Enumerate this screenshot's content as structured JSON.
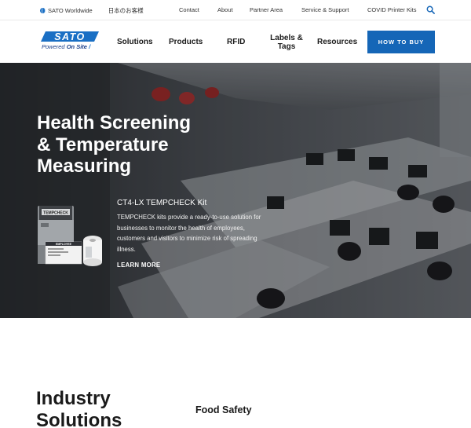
{
  "utility": {
    "worldwide": "SATO Worldwide",
    "japanese": "日本のお客様",
    "links": [
      "Contact",
      "About",
      "Partner Area",
      "Service & Support",
      "COVID Printer Kits"
    ],
    "icons": {
      "globe": "globe-icon",
      "search": "search-icon"
    }
  },
  "logo": {
    "wordmark": "SATO",
    "tagline_prefix": "Powered",
    "tagline_strong": "On Site",
    "tagline_suffix": "/"
  },
  "nav": {
    "solutions": "Solutions",
    "products": "Products",
    "rfid": "RFID",
    "labels_line1": "Labels &",
    "labels_line2": "Tags",
    "resources": "Resources",
    "cta": "HOW TO BUY"
  },
  "hero": {
    "title_line1": "Health Screening",
    "title_line2": "& Temperature",
    "title_line3": "Measuring",
    "kit_title": "CT4-LX TEMPCHECK Kit",
    "kit_desc": "TEMPCHECK kits provide a ready-to-use solution for businesses to monitor the health of employees, customers and visitors to minimize risk of spreading illness.",
    "kit_printer_label": "TEMPCHECK",
    "kit_label_text": "EMPLOYEE",
    "learn_more": "LEARN MORE"
  },
  "industry": {
    "heading_line1": "Industry",
    "heading_line2": "Solutions",
    "food_safety": "Food Safety"
  },
  "colors": {
    "brand_blue": "#1566b7",
    "logo_blue": "#1a3f8a",
    "text_dark": "#1a1a1a"
  }
}
